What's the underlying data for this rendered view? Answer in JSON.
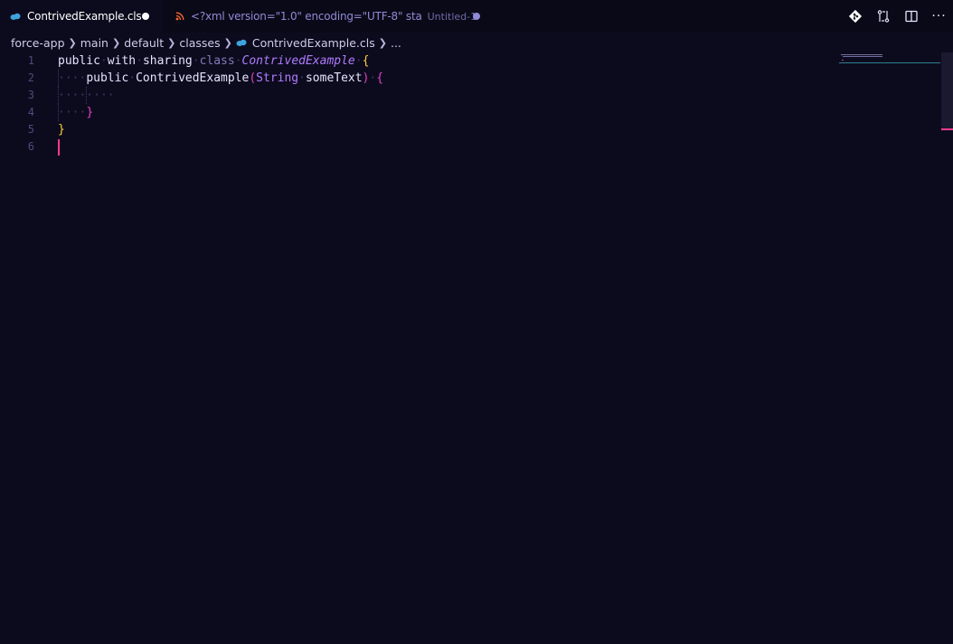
{
  "tabs": {
    "active": {
      "label": "ContrivedExample.cls",
      "icon": "salesforce-cloud-icon",
      "dirty": true
    },
    "inactive": {
      "label": "<?xml version=\"1.0\" encoding=\"UTF-8\" sta",
      "description": "Untitled-1",
      "icon": "rss-xml-icon",
      "dirty": true
    }
  },
  "actions": [
    {
      "name": "git-icon"
    },
    {
      "name": "compare-changes-icon"
    },
    {
      "name": "split-editor-icon"
    },
    {
      "name": "more-actions-icon",
      "glyph": "···"
    }
  ],
  "breadcrumb": {
    "items": [
      "force-app",
      "main",
      "default",
      "classes",
      "ContrivedExample.cls",
      "..."
    ]
  },
  "editor": {
    "line_numbers": [
      "1",
      "2",
      "3",
      "4",
      "5",
      "6"
    ],
    "tokens": {
      "l1_public": "public",
      "l1_with": "with",
      "l1_sharing": "sharing",
      "l1_class": "class",
      "l1_name": "ContrivedExample",
      "l1_brace": "{",
      "l2_public": "public",
      "l2_ctor": "ContrivedExample",
      "l2_paren_open": "(",
      "l2_type": "String",
      "l2_param": "someText",
      "l2_paren_close": ")",
      "l2_brace": "{",
      "l4_brace": "}",
      "l5_brace": "}"
    }
  },
  "colors": {
    "background": "#0c0b1d",
    "cursor": "#ff3b8d",
    "class_name": "#b07bff",
    "brace_yellow": "#ffcf3a",
    "brace_pink": "#e040c8"
  }
}
